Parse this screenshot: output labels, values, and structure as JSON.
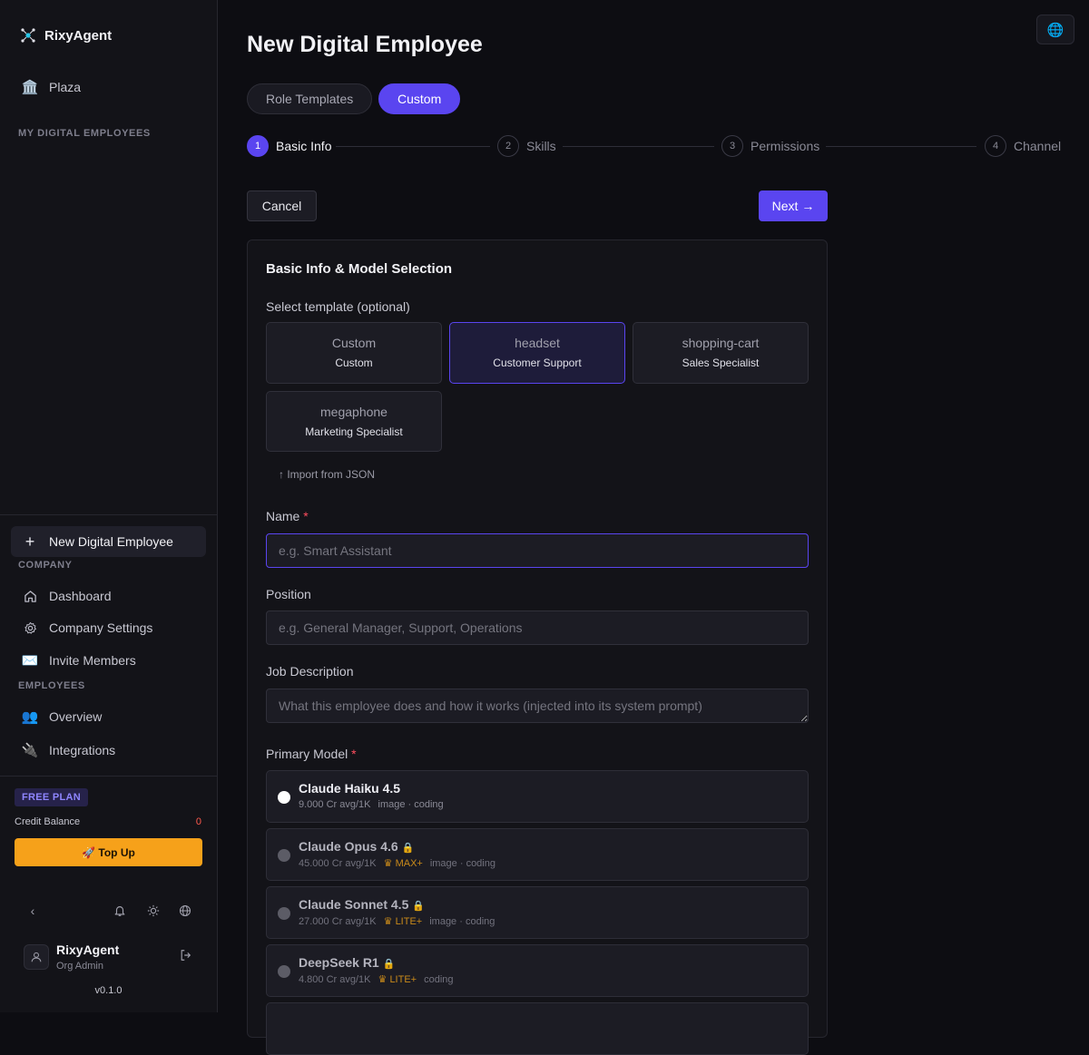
{
  "sidebar": {
    "brand": "RixyAgent",
    "plaza": "Plaza",
    "my_employees_label": "MY DIGITAL EMPLOYEES",
    "new_employee": "New Digital Employee",
    "company_label": "COMPANY",
    "company_items": [
      "Dashboard",
      "Company Settings",
      "Invite Members"
    ],
    "employees_label": "EMPLOYEES",
    "employee_items": [
      "Overview",
      "Integrations"
    ],
    "plan": "FREE PLAN",
    "credit_label": "Credit Balance",
    "credit_value": "0",
    "topup": "🚀 Top Up",
    "user_name": "RixyAgent",
    "user_role": "Org Admin",
    "version": "v0.1.0"
  },
  "page": {
    "title": "New Digital Employee",
    "mode_tabs": [
      "Role Templates",
      "Custom"
    ],
    "active_mode": "Custom",
    "steps": [
      {
        "num": "1",
        "label": "Basic Info"
      },
      {
        "num": "2",
        "label": "Skills"
      },
      {
        "num": "3",
        "label": "Permissions"
      },
      {
        "num": "4",
        "label": "Channel"
      }
    ],
    "cancel": "Cancel",
    "next": "Next →"
  },
  "form": {
    "card_title": "Basic Info & Model Selection",
    "template_label": "Select template (optional)",
    "templates": [
      {
        "icon": "Custom",
        "name": "Custom"
      },
      {
        "icon": "headset",
        "name": "Customer Support"
      },
      {
        "icon": "shopping-cart",
        "name": "Sales Specialist"
      },
      {
        "icon": "megaphone",
        "name": "Marketing Specialist"
      }
    ],
    "selected_template": "Customer Support",
    "import": "↑ Import from JSON",
    "name_label": "Name",
    "required_mark": "*",
    "name_placeholder": "e.g. Smart Assistant",
    "position_label": "Position",
    "position_placeholder": "e.g. General Manager, Support, Operations",
    "job_label": "Job Description",
    "job_placeholder": "What this employee does and how it works (injected into its system prompt)",
    "model_label": "Primary Model",
    "models": [
      {
        "name": "Claude Haiku 4.5",
        "cost": "9.000 Cr avg/1K",
        "tier": "",
        "caps": "image · coding",
        "locked": false
      },
      {
        "name": "Claude Opus 4.6",
        "cost": "45.000 Cr avg/1K",
        "tier": "MAX+",
        "caps": "image · coding",
        "locked": true
      },
      {
        "name": "Claude Sonnet 4.5",
        "cost": "27.000 Cr avg/1K",
        "tier": "LITE+",
        "caps": "image · coding",
        "locked": true
      },
      {
        "name": "DeepSeek R1",
        "cost": "4.800 Cr avg/1K",
        "tier": "LITE+",
        "caps": "coding",
        "locked": true
      }
    ]
  },
  "colors": {
    "accent": "#5a45f0",
    "topup": "#f6a11a",
    "danger": "#ff4d5e"
  }
}
